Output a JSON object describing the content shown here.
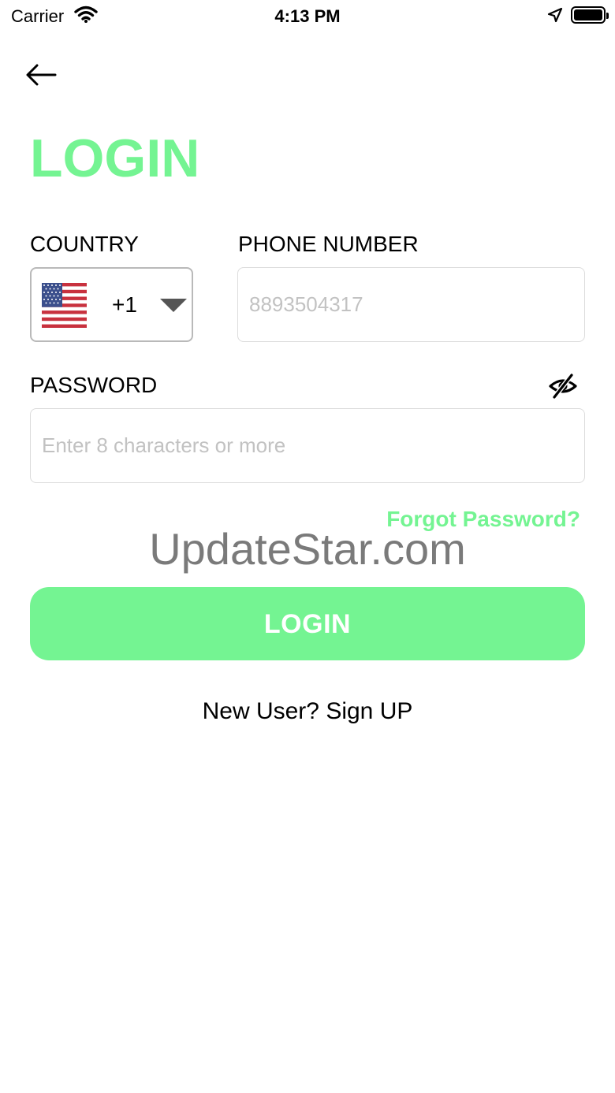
{
  "status_bar": {
    "carrier": "Carrier",
    "time": "4:13 PM"
  },
  "header": {
    "back_icon": "arrow-left-icon",
    "title": "LOGIN"
  },
  "form": {
    "country": {
      "label": "COUNTRY",
      "flag_icon": "us-flag-icon",
      "dial_code": "+1"
    },
    "phone": {
      "label": "PHONE NUMBER",
      "placeholder": "8893504317"
    },
    "password": {
      "label": "PASSWORD",
      "placeholder": "Enter 8 characters or more",
      "visibility_icon": "eye-slash-icon"
    },
    "forgot_password": "Forgot Password?",
    "submit_label": "LOGIN",
    "signup_prompt": "New User? Sign UP"
  },
  "watermark": "UpdateStar.com",
  "colors": {
    "accent": "#74f492",
    "placeholder": "#c2c2c2",
    "border": "#dcdcdc"
  }
}
